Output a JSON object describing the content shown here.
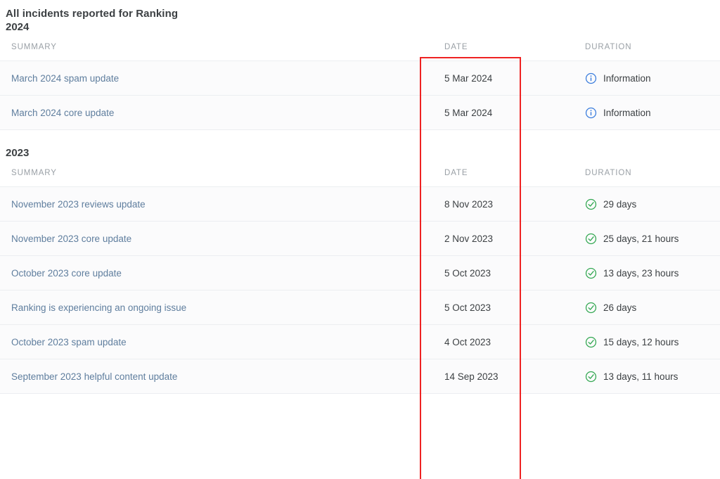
{
  "page": {
    "title": "All incidents reported for Ranking"
  },
  "columns": {
    "summary": "SUMMARY",
    "date": "DATE",
    "duration": "DURATION"
  },
  "icons": {
    "information": "info-circle-icon",
    "resolved": "check-circle-icon"
  },
  "colors": {
    "link": "#5f7e9e",
    "text": "#3c4043",
    "muted": "#9aa0a6",
    "info": "#3b7ddd",
    "resolved": "#34a853",
    "annotation": "#ee2222",
    "row_bg": "#fbfbfc",
    "row_border": "#eceef1"
  },
  "annotation": {
    "label": "date-column-highlight",
    "color": "#ee2222"
  },
  "groups": [
    {
      "year": "2024",
      "rows": [
        {
          "summary": "March 2024 spam update",
          "date": "5 Mar 2024",
          "duration": "Information",
          "status": "information"
        },
        {
          "summary": "March 2024 core update",
          "date": "5 Mar 2024",
          "duration": "Information",
          "status": "information"
        }
      ]
    },
    {
      "year": "2023",
      "rows": [
        {
          "summary": "November 2023 reviews update",
          "date": "8 Nov 2023",
          "duration": "29 days",
          "status": "resolved"
        },
        {
          "summary": "November 2023 core update",
          "date": "2 Nov 2023",
          "duration": "25 days, 21 hours",
          "status": "resolved"
        },
        {
          "summary": "October 2023 core update",
          "date": "5 Oct 2023",
          "duration": "13 days, 23 hours",
          "status": "resolved"
        },
        {
          "summary": "Ranking is experiencing an ongoing issue",
          "date": "5 Oct 2023",
          "duration": "26 days",
          "status": "resolved"
        },
        {
          "summary": "October 2023 spam update",
          "date": "4 Oct 2023",
          "duration": "15 days, 12 hours",
          "status": "resolved"
        },
        {
          "summary": "September 2023 helpful content update",
          "date": "14 Sep 2023",
          "duration": "13 days, 11 hours",
          "status": "resolved"
        }
      ]
    }
  ]
}
